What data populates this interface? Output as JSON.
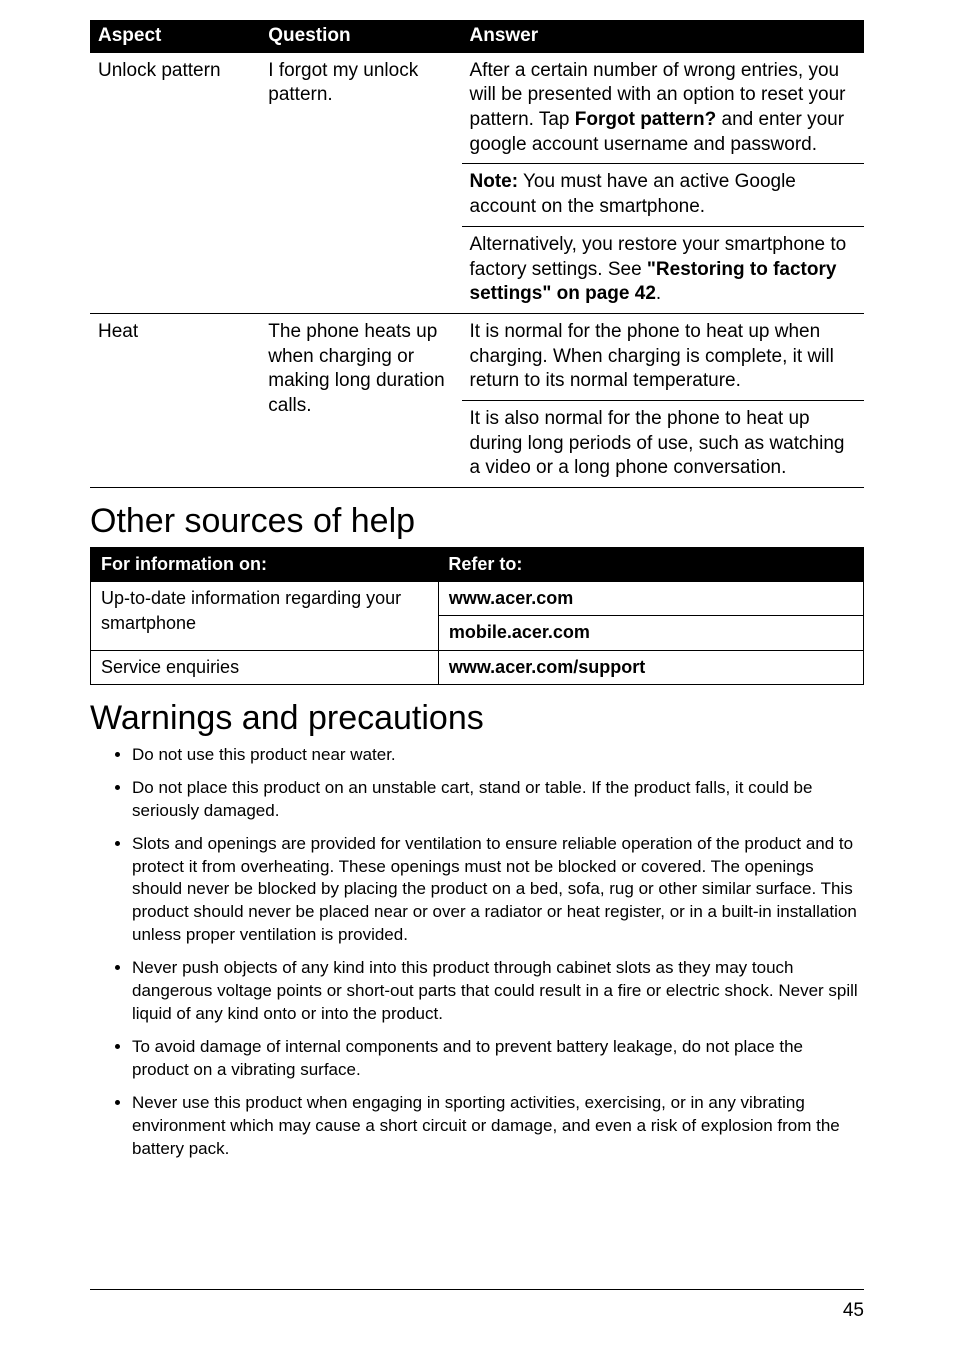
{
  "faq": {
    "headers": {
      "aspect": "Aspect",
      "question": "Question",
      "answer": "Answer"
    },
    "rows": {
      "unlock": {
        "aspect": "Unlock pattern",
        "question": "I forgot my unlock pattern.",
        "answer1_pre": "After a certain number of wrong entries, you will be presented with an option to reset your pattern. Tap ",
        "answer1_bold": "Forgot pattern?",
        "answer1_post": " and enter your google account username and password.",
        "answer2_pre": "Note:",
        "answer2_post": " You must have an active Google account on the smartphone.",
        "answer3_pre": "Alternatively, you restore your smartphone to factory settings. See ",
        "answer3_bold": "\"Restoring to factory settings\" on page 42",
        "answer3_post": "."
      },
      "heat": {
        "aspect": "Heat",
        "question": "The phone heats up when charging or making long duration calls.",
        "answer1": "It is normal for the phone to heat up when charging. When charging is complete, it will return to its normal temperature.",
        "answer2": "It is also normal for the phone to heat up during long periods of use, such as watching a video or a long phone conversation."
      }
    }
  },
  "sections": {
    "other_sources": "Other sources of help",
    "warnings": "Warnings and precautions"
  },
  "sources": {
    "headers": {
      "left": "For information on:",
      "right": "Refer to:"
    },
    "rows": {
      "uptodate": "Up-to-date information regarding your smartphone",
      "url1": "www.acer.com",
      "url2": "mobile.acer.com",
      "service": "Service enquiries",
      "support": "www.acer.com/support"
    }
  },
  "warnings": [
    "Do not use this product near water.",
    "Do not place this product on an unstable cart, stand or table. If the product falls, it could be seriously damaged.",
    "Slots and openings are provided for ventilation to ensure reliable operation of the product and to protect it from overheating. These openings must not be blocked or covered. The openings should never be blocked by placing the product on a bed, sofa, rug or other similar surface. This product should never be placed near or over a radiator or heat register, or in a built-in installation unless proper ventilation is provided.",
    "Never push objects of any kind into this product through cabinet slots as they may touch dangerous voltage points or short-out parts that could result in a fire or electric shock. Never spill liquid of any kind onto or into the product.",
    "To avoid damage of internal components and to prevent battery leakage, do not place the product on a vibrating surface.",
    "Never use this product when engaging in sporting activities, exercising, or in any vibrating environment which may cause a short circuit or damage, and even a risk of explosion from the battery pack."
  ],
  "page_number": "45"
}
